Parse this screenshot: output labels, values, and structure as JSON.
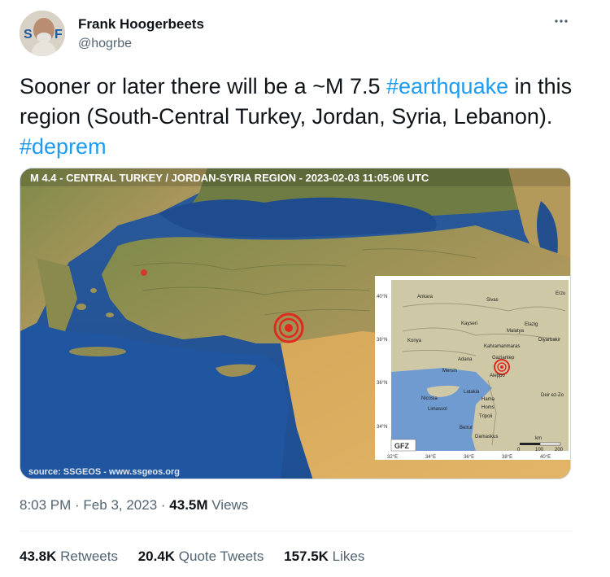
{
  "author": {
    "name": "Frank Hoogerbeets",
    "handle": "@hogrbe",
    "avatar_text": "S  F"
  },
  "tweet": {
    "text_pre": "Sooner or later there will be a ~M 7.5 ",
    "hashtag1": "#earthquake",
    "text_mid": " in this region (South-Central Turkey, Jordan, Syria, Lebanon). ",
    "hashtag2": "#deprem"
  },
  "media": {
    "title": "M 4.4 - CENTRAL TURKEY / JORDAN-SYRIA REGION - 2023-02-03 11:05:06 UTC",
    "source": "source: SSGEOS - www.ssgeos.org",
    "inset_logo": "GFZ",
    "inset_lat_labels": [
      "40°N",
      "38°N",
      "36°N",
      "34°N"
    ],
    "inset_lon_labels": [
      "32°E",
      "34°E",
      "36°E",
      "38°E",
      "40°E"
    ],
    "inset_cities": [
      "Ankara",
      "Sivas",
      "Erzu",
      "Kayseri",
      "Malatya",
      "Elazig",
      "Konya",
      "Kahramanmaras",
      "Diyarbakir",
      "Adana",
      "Gaziantep",
      "Mersin",
      "Aleppo",
      "Latakia",
      "Hama",
      "Homs",
      "Deir ez-Zo",
      "Nicosia",
      "Limassol",
      "Tripoli",
      "Beirut",
      "Damaskus"
    ],
    "scale_unit": "km",
    "scale_labels": [
      "0",
      "100",
      "200"
    ]
  },
  "meta": {
    "time": "8:03 PM",
    "sep1": " · ",
    "date": "Feb 3, 2023",
    "sep2": " · ",
    "views_count": "43.5M",
    "views_label": " Views"
  },
  "stats": {
    "retweets_count": "43.8K",
    "retweets_label": " Retweets",
    "quotes_count": "20.4K",
    "quotes_label": " Quote Tweets",
    "likes_count": "157.5K",
    "likes_label": " Likes"
  },
  "icons": {
    "more": "more-icon"
  }
}
